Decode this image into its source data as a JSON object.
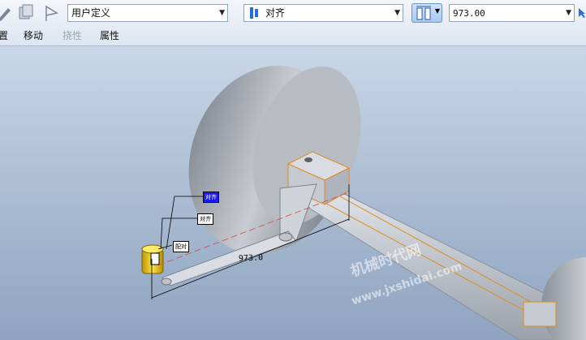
{
  "toolbar": {
    "constraint_type_value": "用户定义",
    "alignment_value": "对齐",
    "offset_value": "973.00"
  },
  "menu": {
    "items": [
      {
        "label": "置",
        "enabled": true
      },
      {
        "label": "移动",
        "enabled": true
      },
      {
        "label": "挠性",
        "enabled": false
      },
      {
        "label": "属性",
        "enabled": true
      }
    ]
  },
  "viewport": {
    "dimension_value": "973.0",
    "tag_1": "对齐",
    "tag_2": "对齐",
    "tag_3": "配对",
    "watermark_1": "机械时代网",
    "watermark_2": "www.jxshidai.com"
  },
  "colors": {
    "accent": "#1a1aff",
    "highlight": "#e08a1e",
    "part_yellow": "#e6c200"
  }
}
